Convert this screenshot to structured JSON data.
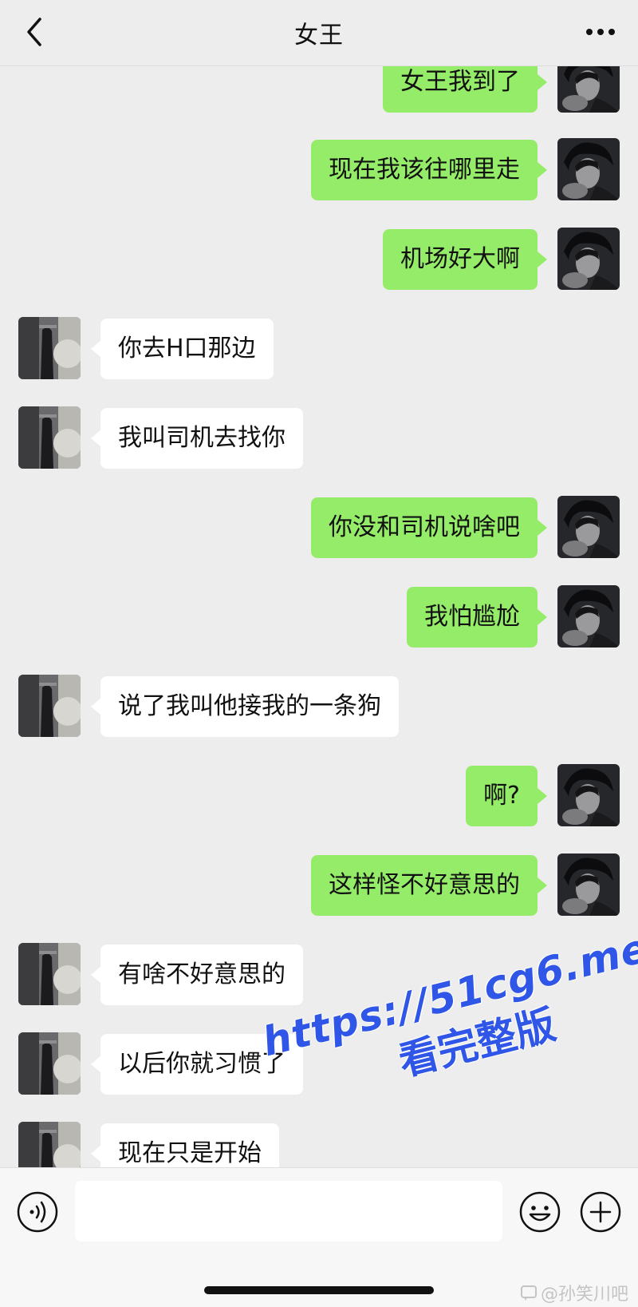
{
  "header": {
    "title": "女王"
  },
  "messages": [
    {
      "side": "out",
      "text": "女王我到了"
    },
    {
      "side": "out",
      "text": "现在我该往哪里走"
    },
    {
      "side": "out",
      "text": "机场好大啊"
    },
    {
      "side": "in",
      "text": "你去H口那边"
    },
    {
      "side": "in",
      "text": "我叫司机去找你"
    },
    {
      "side": "out",
      "text": "你没和司机说啥吧"
    },
    {
      "side": "out",
      "text": "我怕尴尬"
    },
    {
      "side": "in",
      "text": "说了我叫他接我的一条狗"
    },
    {
      "side": "out",
      "text": "啊?"
    },
    {
      "side": "out",
      "text": "这样怪不好意思的"
    },
    {
      "side": "in",
      "text": "有啥不好意思的"
    },
    {
      "side": "in",
      "text": "以后你就习惯了"
    },
    {
      "side": "in",
      "text": "现在只是开始"
    }
  ],
  "input": {
    "value": "",
    "placeholder": ""
  },
  "watermark": {
    "url": "https://51cg6.me",
    "subtitle": "看完整版"
  },
  "footer_mark": "@孙笑川吧",
  "colors": {
    "background": "#ededed",
    "outgoing_bubble": "#95ec69",
    "incoming_bubble": "#ffffff",
    "watermark": "#2f56e6"
  },
  "icons": {
    "back": "chevron-left-icon",
    "more": "more-dots-icon",
    "voice": "voice-icon",
    "emoji": "emoji-icon",
    "plus": "plus-icon"
  }
}
